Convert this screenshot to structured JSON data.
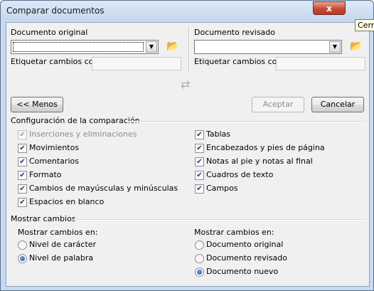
{
  "window": {
    "title": "Comparar documentos",
    "close_glyph": "x",
    "tooltip": "Cerrar"
  },
  "original": {
    "label": "Documento original",
    "value": "",
    "tag_label": "Etiquetar cambios con",
    "tag_value": ""
  },
  "revised": {
    "label": "Documento revisado",
    "value": "",
    "tag_label": "Etiquetar cambios con",
    "tag_value": ""
  },
  "buttons": {
    "less": "<< Menos",
    "accept": "Aceptar",
    "cancel": "Cancelar"
  },
  "comparison": {
    "heading": "Configuración de la comparación",
    "left": [
      {
        "label": "Inserciones y eliminaciones",
        "checked": true,
        "disabled": true
      },
      {
        "label": "Movimientos",
        "checked": true,
        "disabled": false
      },
      {
        "label": "Comentarios",
        "checked": true,
        "disabled": false
      },
      {
        "label": "Formato",
        "checked": true,
        "disabled": false
      },
      {
        "label": "Cambios de mayúsculas y minúsculas",
        "checked": true,
        "disabled": false
      },
      {
        "label": "Espacios en blanco",
        "checked": true,
        "disabled": false
      }
    ],
    "right": [
      {
        "label": "Tablas",
        "checked": true
      },
      {
        "label": "Encabezados y pies de página",
        "checked": true
      },
      {
        "label": "Notas al pie y notas al final",
        "checked": true
      },
      {
        "label": "Cuadros de texto",
        "checked": true
      },
      {
        "label": "Campos",
        "checked": true
      }
    ]
  },
  "show": {
    "heading": "Mostrar cambios",
    "level_label": "Mostrar cambios en:",
    "level_options": [
      {
        "label": "Nivel de carácter",
        "selected": false
      },
      {
        "label": "Nivel de palabra",
        "selected": true
      }
    ],
    "doc_label": "Mostrar cambios en:",
    "doc_options": [
      {
        "label": "Documento original",
        "selected": false
      },
      {
        "label": "Documento revisado",
        "selected": false
      },
      {
        "label": "Documento nuevo",
        "selected": true
      }
    ]
  },
  "icons": {
    "folder": "open-folder-icon",
    "swap": "swap-arrows-icon",
    "dropdown": "chevron-down-icon",
    "check": "check-icon"
  }
}
